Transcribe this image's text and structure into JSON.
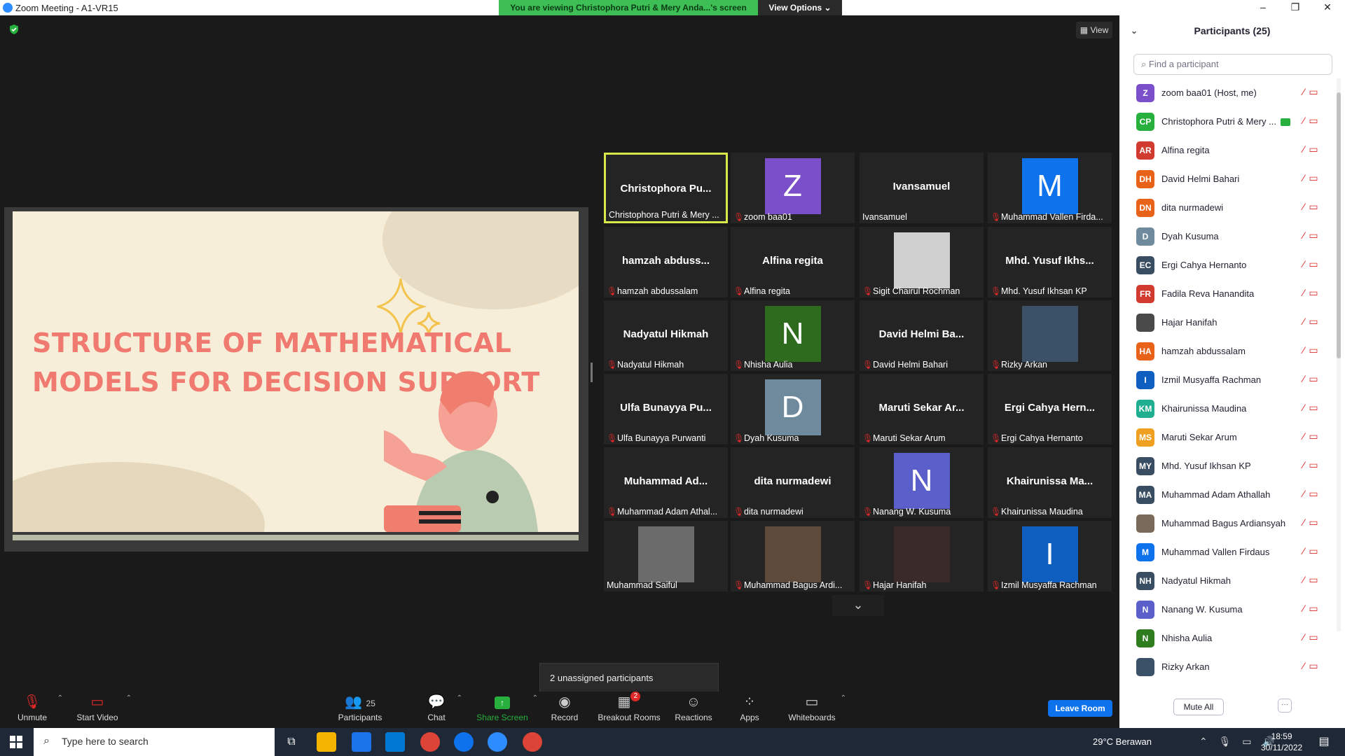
{
  "window": {
    "title": "Zoom Meeting - A1-VR15",
    "minimize": "–",
    "maximize": "❐",
    "close": "✕"
  },
  "banner": {
    "text": "You are viewing Christophora Putri & Mery Anda...'s screen",
    "view_options": "View Options ⌄"
  },
  "meeting": {
    "view_label": "▦ View"
  },
  "slide": {
    "line1": "STRUCTURE OF MATHEMATICAL",
    "line2": "MODELS FOR DECISION SUPPORT"
  },
  "tiles": [
    {
      "big": "Christophora Pu...",
      "label": "Christophora Putri & Mery ...",
      "muted": false,
      "active": true
    },
    {
      "avatar": "Z",
      "avatar_color": "#7b4fc9",
      "label": "zoom baa01",
      "muted": true
    },
    {
      "big": "Ivansamuel",
      "label": "Ivansamuel",
      "muted": false
    },
    {
      "avatar": "M",
      "avatar_color": "#0e72ed",
      "label": "Muhammad Vallen Firda...",
      "muted": true
    },
    {
      "big": "hamzah abduss...",
      "label": "hamzah abdussalam",
      "muted": true
    },
    {
      "big": "Alfina regita",
      "label": "Alfina regita",
      "muted": true
    },
    {
      "photo": "#cfcfcf",
      "label": "Sigit Chairul Rochman",
      "muted": true
    },
    {
      "big": "Mhd. Yusuf Ikhs...",
      "label": "Mhd. Yusuf Ikhsan KP",
      "muted": true
    },
    {
      "big": "Nadyatul Hikmah",
      "label": "Nadyatul Hikmah",
      "muted": true
    },
    {
      "avatar": "N",
      "avatar_color": "#2e6b1f",
      "label": "Nhisha Aulia",
      "muted": true
    },
    {
      "big": "David Helmi Ba...",
      "label": "David Helmi Bahari",
      "muted": true
    },
    {
      "photo": "#3b5168",
      "label": "Rizky Arkan",
      "muted": true
    },
    {
      "big": "Ulfa Bunayya Pu...",
      "label": "Ulfa Bunayya Purwanti",
      "muted": true
    },
    {
      "avatar": "D",
      "avatar_color": "#6f8a9c",
      "label": "Dyah Kusuma",
      "muted": true
    },
    {
      "big": "Maruti Sekar Ar...",
      "label": "Maruti Sekar Arum",
      "muted": true
    },
    {
      "big": "Ergi Cahya Hern...",
      "label": "Ergi Cahya Hernanto",
      "muted": true
    },
    {
      "big": "Muhammad Ad...",
      "label": "Muhammad Adam Athal...",
      "muted": true
    },
    {
      "big": "dita nurmadewi",
      "label": "dita nurmadewi",
      "muted": true
    },
    {
      "avatar": "N",
      "avatar_color": "#5a5fc9",
      "label": "Nanang W. Kusuma",
      "muted": true
    },
    {
      "big": "Khairunissa Ma...",
      "label": "Khairunissa Maudina",
      "muted": true
    },
    {
      "photo": "#6b6b6b",
      "label": "Muhammad Saiful",
      "muted": false
    },
    {
      "photo": "#5d4a3a",
      "label": "Muhammad Bagus Ardi...",
      "muted": true
    },
    {
      "photo": "#3a2a2a",
      "label": "Hajar Hanifah",
      "muted": true
    },
    {
      "avatar": "I",
      "avatar_color": "#0e5fbf",
      "label": "Izmil Musyaffa Rachman",
      "muted": true
    }
  ],
  "scroll_down": "⌄",
  "unassigned": "2 unassigned participants",
  "toolbar": {
    "unmute": "Unmute",
    "start_video": "Start Video",
    "participants": "Participants",
    "participants_count": "25",
    "chat": "Chat",
    "share_screen": "Share Screen",
    "record": "Record",
    "breakout": "Breakout Rooms",
    "breakout_badge": "2",
    "reactions": "Reactions",
    "apps": "Apps",
    "whiteboards": "Whiteboards",
    "leave": "Leave Room"
  },
  "panel": {
    "title": "Participants (25)",
    "collapse": "⌄",
    "search_placeholder": "Find a participant",
    "mute_all": "Mute All",
    "more": "···",
    "participants": [
      {
        "initials": "Z",
        "color": "#7b4fc9",
        "name": "zoom baa01 (Host, me)"
      },
      {
        "initials": "CP",
        "color": "#27b03e",
        "name": "Christophora Putri & Mery ...",
        "sharing": true
      },
      {
        "initials": "AR",
        "color": "#d03a2f",
        "name": "Alfina regita"
      },
      {
        "initials": "DH",
        "color": "#e8621a",
        "name": "David Helmi Bahari"
      },
      {
        "initials": "DN",
        "color": "#e8621a",
        "name": "dita nurmadewi"
      },
      {
        "initials": "D",
        "color": "#6f8a9c",
        "name": "Dyah Kusuma"
      },
      {
        "initials": "EC",
        "color": "#3a4e63",
        "name": "Ergi Cahya Hernanto"
      },
      {
        "initials": "FR",
        "color": "#d03a2f",
        "name": "Fadila Reva Hanandita"
      },
      {
        "initials": "",
        "color": "#4a4a4a",
        "name": "Hajar Hanifah"
      },
      {
        "initials": "HA",
        "color": "#e8621a",
        "name": "hamzah abdussalam"
      },
      {
        "initials": "I",
        "color": "#0e5fbf",
        "name": "Izmil Musyaffa Rachman"
      },
      {
        "initials": "KM",
        "color": "#1fae8f",
        "name": "Khairunissa Maudina"
      },
      {
        "initials": "MS",
        "color": "#f0a020",
        "name": "Maruti Sekar Arum"
      },
      {
        "initials": "MY",
        "color": "#3a4e63",
        "name": "Mhd. Yusuf Ikhsan KP"
      },
      {
        "initials": "MA",
        "color": "#3a4e63",
        "name": "Muhammad Adam Athallah"
      },
      {
        "initials": "",
        "color": "#7a6a5a",
        "name": "Muhammad Bagus Ardiansyah"
      },
      {
        "initials": "M",
        "color": "#0e72ed",
        "name": "Muhammad Vallen Firdaus"
      },
      {
        "initials": "NH",
        "color": "#3a4e63",
        "name": "Nadyatul Hikmah"
      },
      {
        "initials": "N",
        "color": "#5a5fc9",
        "name": "Nanang W. Kusuma"
      },
      {
        "initials": "N",
        "color": "#2e7d1f",
        "name": "Nhisha Aulia"
      },
      {
        "initials": "",
        "color": "#3b5168",
        "name": "Rizky Arkan"
      }
    ]
  },
  "taskbar": {
    "search_placeholder": "Type here to search",
    "weather": "29°C  Berawan",
    "time": "18:59",
    "date": "30/11/2022"
  }
}
